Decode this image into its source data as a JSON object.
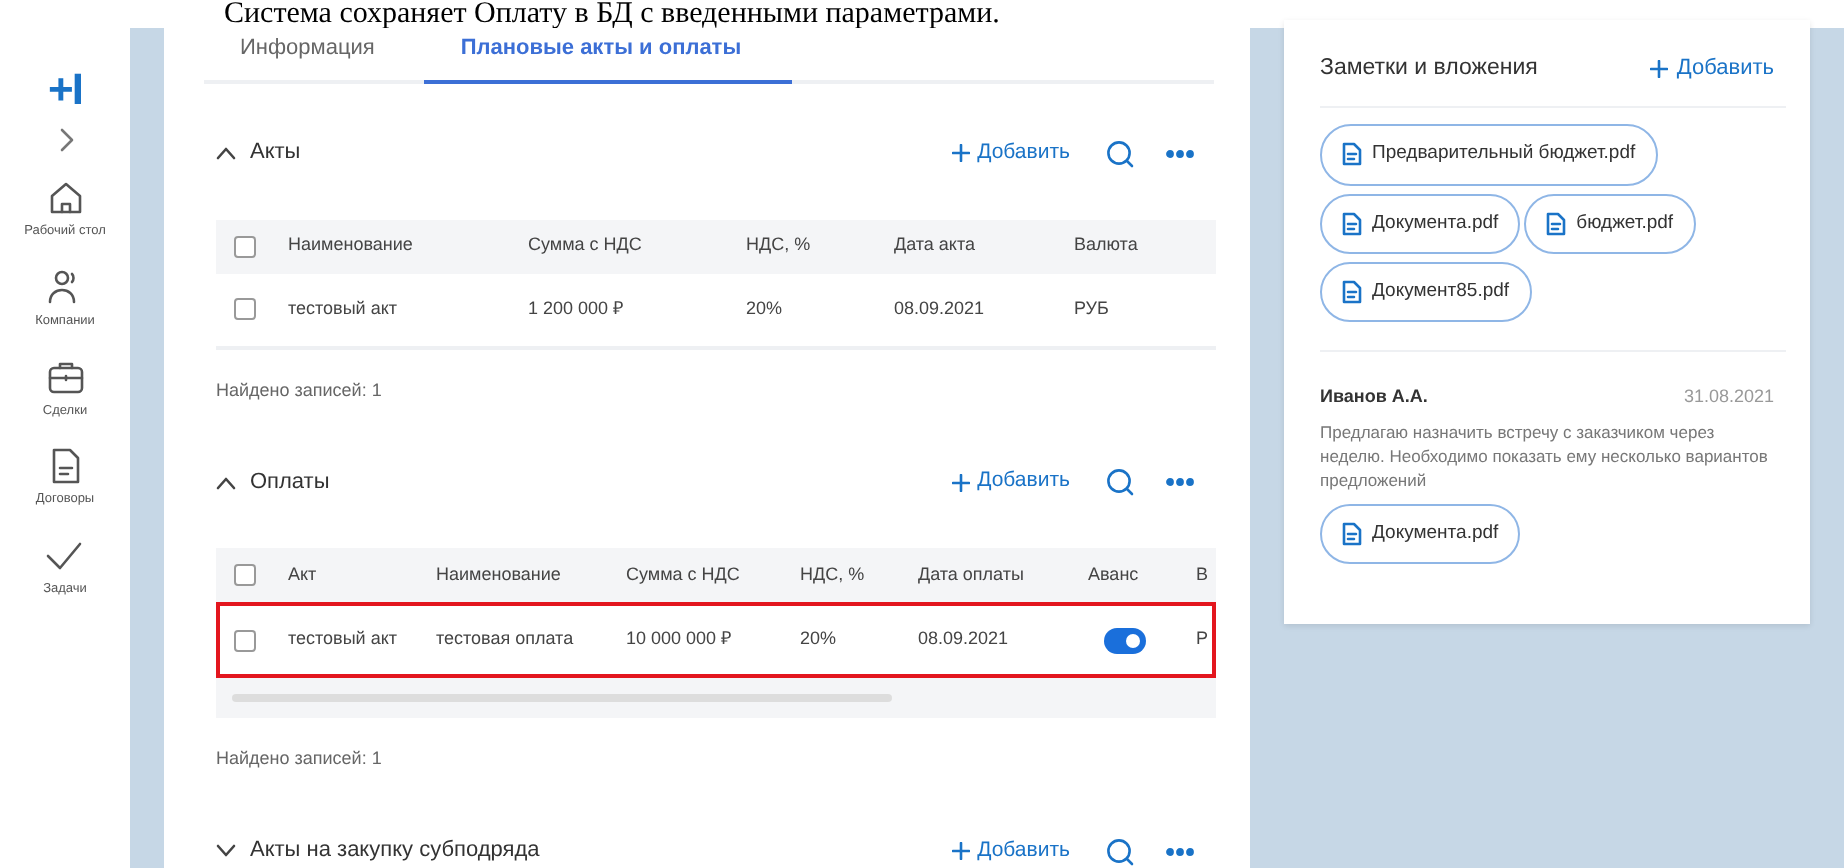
{
  "caption": "Система сохраняет Оплату в БД с введенными параметрами.",
  "sidebar": {
    "logo": "+I",
    "items": [
      {
        "kind": "home",
        "label": "Рабочий стол"
      },
      {
        "kind": "people",
        "label": "Компании"
      },
      {
        "kind": "briefcase",
        "label": "Сделки"
      },
      {
        "kind": "document",
        "label": "Договоры"
      },
      {
        "kind": "check",
        "label": "Задачи"
      }
    ]
  },
  "tabs": [
    {
      "label": "Информация",
      "selected": false
    },
    {
      "label": "Плановые акты и оплаты",
      "selected": true
    }
  ],
  "sections": [
    {
      "title": "Акты",
      "expanded": true,
      "add_label": "Добавить",
      "table": {
        "header_checked": false,
        "columns": [
          "Наименование",
          "Сумма с НДС",
          "НДС, %",
          "Дата акта",
          "Валюта"
        ],
        "rows": [
          {
            "checked": false,
            "highlighted": false,
            "cells": [
              {
                "kind": "text",
                "text": "тестовый акт"
              },
              {
                "kind": "text",
                "text": "1 200 000 ₽"
              },
              {
                "kind": "text",
                "text": "20%"
              },
              {
                "kind": "text",
                "text": "08.09.2021"
              },
              {
                "kind": "text",
                "text": "РУБ"
              }
            ]
          }
        ]
      },
      "found": "Найдено записей: 1"
    },
    {
      "title": "Оплаты",
      "expanded": true,
      "add_label": "Добавить",
      "table": {
        "header_checked": false,
        "columns": [
          "Акт",
          "Наименование",
          "Сумма с НДС",
          "НДС, %",
          "Дата оплаты",
          "Аванс",
          "В"
        ],
        "rows": [
          {
            "checked": false,
            "highlighted": true,
            "cells": [
              {
                "kind": "text",
                "text": "тестовый акт"
              },
              {
                "kind": "text",
                "text": "тестовая оплата"
              },
              {
                "kind": "text",
                "text": "10 000 000 ₽"
              },
              {
                "kind": "text",
                "text": "20%"
              },
              {
                "kind": "text",
                "text": "08.09.2021"
              },
              {
                "kind": "toggle",
                "on": true
              },
              {
                "kind": "text",
                "text": "Р"
              }
            ]
          }
        ]
      },
      "found": "Найдено записей: 1"
    },
    {
      "title": "Акты на закупку субподряда",
      "expanded": false,
      "add_label": "Добавить"
    }
  ],
  "notes_panel": {
    "title": "Заметки и вложения",
    "add_label": "Добавить",
    "attachments": [
      "Предварительный бюджет.pdf",
      "Документа.pdf",
      "бюджет.pdf",
      "Документ85.pdf"
    ],
    "notes": [
      {
        "author": "Иванов А.А.",
        "date": "31.08.2021",
        "text": "Предлагаю назначить встречу с заказчиком через неделю. Необходимо показать ему несколько вариантов предложений",
        "attachments": [
          "Документа.pdf"
        ]
      }
    ]
  }
}
